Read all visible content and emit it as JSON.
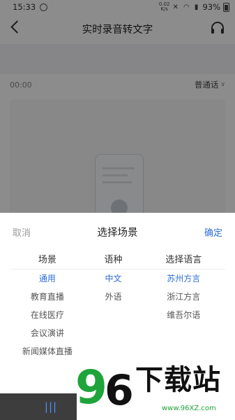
{
  "statusbar": {
    "time": "15:33",
    "speed_top": "0.02",
    "speed_bottom": "K/s",
    "battery": "93%"
  },
  "header": {
    "title": "实时录音转文字"
  },
  "recorder": {
    "timer": "00:00",
    "dialect": "普通话"
  },
  "sheet": {
    "cancel": "取消",
    "title": "选择场景",
    "confirm": "确定",
    "columns": [
      {
        "header": "场景",
        "options": [
          "通用",
          "教育直播",
          "在线医疗",
          "会议演讲",
          "新闻媒体直播"
        ],
        "selected_index": 0
      },
      {
        "header": "语种",
        "options": [
          "中文",
          "外语"
        ],
        "selected_index": 0
      },
      {
        "header": "选择语言",
        "options": [
          "苏州方言",
          "浙江方言",
          "维吾尔语"
        ],
        "selected_index": 0
      }
    ]
  },
  "watermark": {
    "digits_a": "9",
    "digits_b": "6",
    "brand": "下载站",
    "url": "www.96XZ.com"
  },
  "colors": {
    "accent": "#2f6fd8",
    "watermark_green": "#1ea43a",
    "overlay": "rgba(0,0,0,0.45)"
  }
}
